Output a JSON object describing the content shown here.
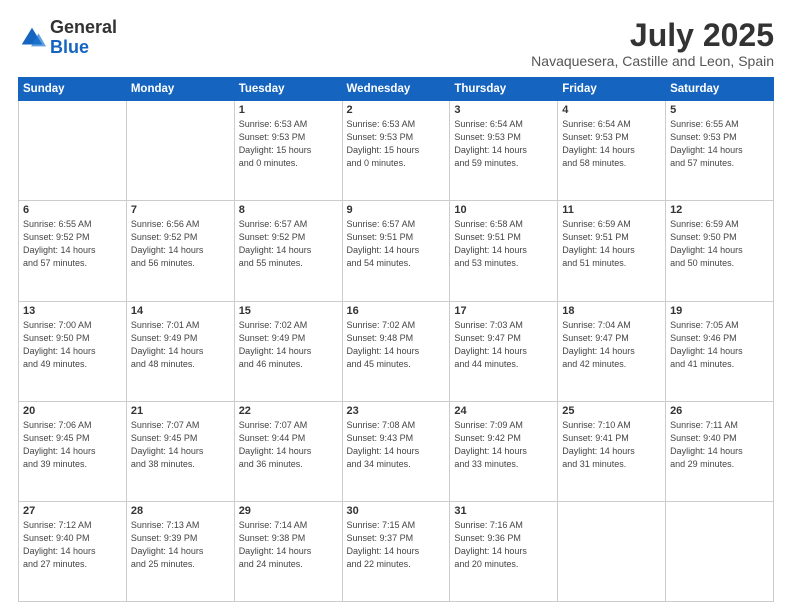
{
  "header": {
    "logo_general": "General",
    "logo_blue": "Blue",
    "month_year": "July 2025",
    "location": "Navaquesera, Castille and Leon, Spain"
  },
  "weekdays": [
    "Sunday",
    "Monday",
    "Tuesday",
    "Wednesday",
    "Thursday",
    "Friday",
    "Saturday"
  ],
  "weeks": [
    [
      {
        "day": "",
        "info": ""
      },
      {
        "day": "",
        "info": ""
      },
      {
        "day": "1",
        "info": "Sunrise: 6:53 AM\nSunset: 9:53 PM\nDaylight: 15 hours\nand 0 minutes."
      },
      {
        "day": "2",
        "info": "Sunrise: 6:53 AM\nSunset: 9:53 PM\nDaylight: 15 hours\nand 0 minutes."
      },
      {
        "day": "3",
        "info": "Sunrise: 6:54 AM\nSunset: 9:53 PM\nDaylight: 14 hours\nand 59 minutes."
      },
      {
        "day": "4",
        "info": "Sunrise: 6:54 AM\nSunset: 9:53 PM\nDaylight: 14 hours\nand 58 minutes."
      },
      {
        "day": "5",
        "info": "Sunrise: 6:55 AM\nSunset: 9:53 PM\nDaylight: 14 hours\nand 57 minutes."
      }
    ],
    [
      {
        "day": "6",
        "info": "Sunrise: 6:55 AM\nSunset: 9:52 PM\nDaylight: 14 hours\nand 57 minutes."
      },
      {
        "day": "7",
        "info": "Sunrise: 6:56 AM\nSunset: 9:52 PM\nDaylight: 14 hours\nand 56 minutes."
      },
      {
        "day": "8",
        "info": "Sunrise: 6:57 AM\nSunset: 9:52 PM\nDaylight: 14 hours\nand 55 minutes."
      },
      {
        "day": "9",
        "info": "Sunrise: 6:57 AM\nSunset: 9:51 PM\nDaylight: 14 hours\nand 54 minutes."
      },
      {
        "day": "10",
        "info": "Sunrise: 6:58 AM\nSunset: 9:51 PM\nDaylight: 14 hours\nand 53 minutes."
      },
      {
        "day": "11",
        "info": "Sunrise: 6:59 AM\nSunset: 9:51 PM\nDaylight: 14 hours\nand 51 minutes."
      },
      {
        "day": "12",
        "info": "Sunrise: 6:59 AM\nSunset: 9:50 PM\nDaylight: 14 hours\nand 50 minutes."
      }
    ],
    [
      {
        "day": "13",
        "info": "Sunrise: 7:00 AM\nSunset: 9:50 PM\nDaylight: 14 hours\nand 49 minutes."
      },
      {
        "day": "14",
        "info": "Sunrise: 7:01 AM\nSunset: 9:49 PM\nDaylight: 14 hours\nand 48 minutes."
      },
      {
        "day": "15",
        "info": "Sunrise: 7:02 AM\nSunset: 9:49 PM\nDaylight: 14 hours\nand 46 minutes."
      },
      {
        "day": "16",
        "info": "Sunrise: 7:02 AM\nSunset: 9:48 PM\nDaylight: 14 hours\nand 45 minutes."
      },
      {
        "day": "17",
        "info": "Sunrise: 7:03 AM\nSunset: 9:47 PM\nDaylight: 14 hours\nand 44 minutes."
      },
      {
        "day": "18",
        "info": "Sunrise: 7:04 AM\nSunset: 9:47 PM\nDaylight: 14 hours\nand 42 minutes."
      },
      {
        "day": "19",
        "info": "Sunrise: 7:05 AM\nSunset: 9:46 PM\nDaylight: 14 hours\nand 41 minutes."
      }
    ],
    [
      {
        "day": "20",
        "info": "Sunrise: 7:06 AM\nSunset: 9:45 PM\nDaylight: 14 hours\nand 39 minutes."
      },
      {
        "day": "21",
        "info": "Sunrise: 7:07 AM\nSunset: 9:45 PM\nDaylight: 14 hours\nand 38 minutes."
      },
      {
        "day": "22",
        "info": "Sunrise: 7:07 AM\nSunset: 9:44 PM\nDaylight: 14 hours\nand 36 minutes."
      },
      {
        "day": "23",
        "info": "Sunrise: 7:08 AM\nSunset: 9:43 PM\nDaylight: 14 hours\nand 34 minutes."
      },
      {
        "day": "24",
        "info": "Sunrise: 7:09 AM\nSunset: 9:42 PM\nDaylight: 14 hours\nand 33 minutes."
      },
      {
        "day": "25",
        "info": "Sunrise: 7:10 AM\nSunset: 9:41 PM\nDaylight: 14 hours\nand 31 minutes."
      },
      {
        "day": "26",
        "info": "Sunrise: 7:11 AM\nSunset: 9:40 PM\nDaylight: 14 hours\nand 29 minutes."
      }
    ],
    [
      {
        "day": "27",
        "info": "Sunrise: 7:12 AM\nSunset: 9:40 PM\nDaylight: 14 hours\nand 27 minutes."
      },
      {
        "day": "28",
        "info": "Sunrise: 7:13 AM\nSunset: 9:39 PM\nDaylight: 14 hours\nand 25 minutes."
      },
      {
        "day": "29",
        "info": "Sunrise: 7:14 AM\nSunset: 9:38 PM\nDaylight: 14 hours\nand 24 minutes."
      },
      {
        "day": "30",
        "info": "Sunrise: 7:15 AM\nSunset: 9:37 PM\nDaylight: 14 hours\nand 22 minutes."
      },
      {
        "day": "31",
        "info": "Sunrise: 7:16 AM\nSunset: 9:36 PM\nDaylight: 14 hours\nand 20 minutes."
      },
      {
        "day": "",
        "info": ""
      },
      {
        "day": "",
        "info": ""
      }
    ]
  ]
}
